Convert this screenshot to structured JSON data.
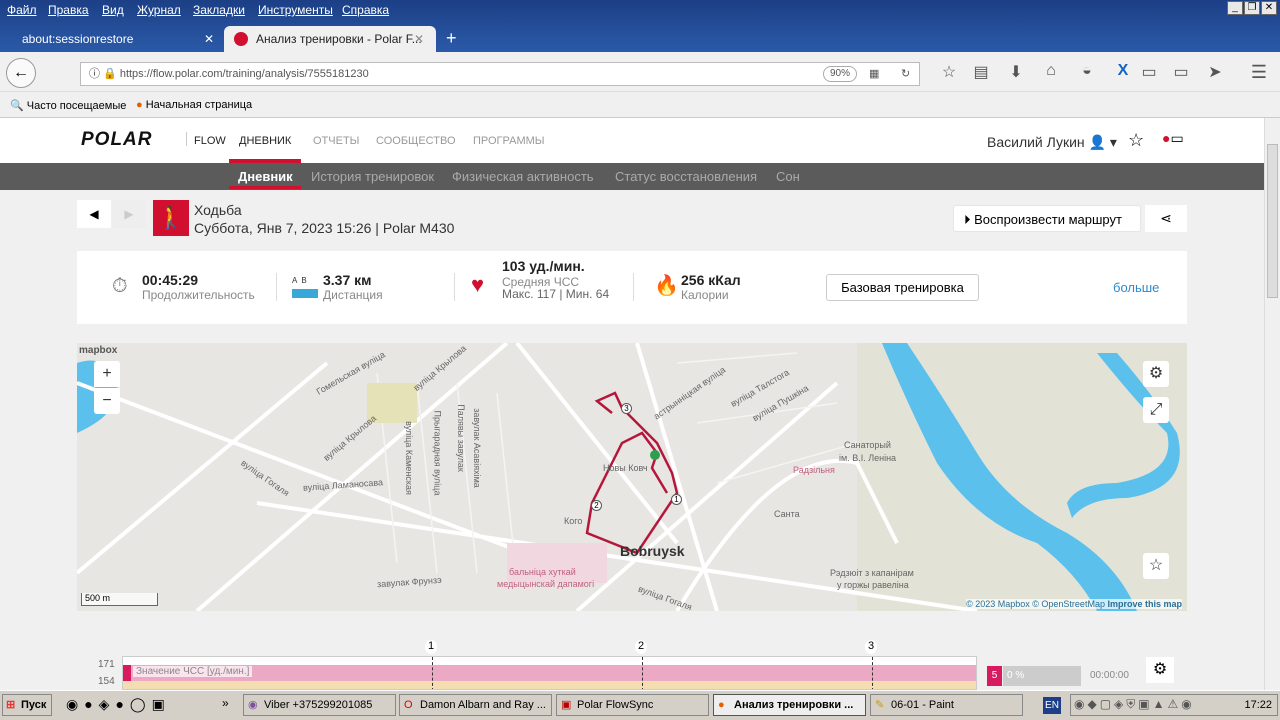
{
  "browser": {
    "menu": [
      "Файл",
      "Правка",
      "Вид",
      "Журнал",
      "Закладки",
      "Инструменты",
      "Справка"
    ],
    "tabs": [
      {
        "label": "about:sessionrestore"
      },
      {
        "label": "Анализ тренировки - Polar F..."
      }
    ],
    "url": "https://flow.polar.com/training/analysis/7555181230",
    "zoom": "90%",
    "bookmarks": [
      "Часто посещаемые",
      "Начальная страница"
    ]
  },
  "site": {
    "logo": "POLAR",
    "flow": "FLOW",
    "topnav": [
      "ДНЕВНИК",
      "ОТЧЕТЫ",
      "СООБЩЕСТВО",
      "ПРОГРАММЫ"
    ],
    "user": "Василий Лукин",
    "subnav": [
      "Дневник",
      "История тренировок",
      "Физическая активность",
      "Статус восстановления",
      "Сон"
    ]
  },
  "training": {
    "sport": "Ходьба",
    "date": "Суббота, Янв 7, 2023 15:26 | Polar M430",
    "replay": "Воспроизвести маршрут",
    "duration": "00:45:29",
    "duration_label": "Продолжительность",
    "distance_ab": "A  B",
    "distance": "3.37 км",
    "distance_label": "Дистанция",
    "hr": "103 уд./мин.",
    "hr_label": "Средняя ЧСС",
    "hr_minmax": "Макс. 117  |  Мин. 64",
    "calories": "256 кКал",
    "calories_label": "Калории",
    "type_button": "Базовая тренировка",
    "more": "больше"
  },
  "map": {
    "brand": "mapbox",
    "scale": "500 m",
    "attribution": [
      "© 2023 Mapbox",
      "© OpenStreetMap",
      "Improve this map"
    ],
    "labels": [
      "вуліца Гогаля",
      "вуліца Крылова",
      "вуліца Крылова",
      "Гомельская вуліца",
      "вуліца Ламаносава",
      "вуліца Каменская",
      "Прыгарадная вуліца",
      "Палявы завулак",
      "завулак Асавіяхіма",
      "завулак Фрунзэ",
      "бальніца хуткай",
      "медыцынскай дапамогі",
      "Bobruysk",
      "Радзільня",
      "Санаторый",
      "ім. В.І. Леніна",
      "Санта",
      "Рэдзюіт з капанірам",
      "у горжы равеліна",
      "вуліца Талстога",
      "вуліца Пушкіна",
      "астрынніцкая вуліца",
      "вуліца Гогаля",
      "Кого",
      "Новы Ковч"
    ],
    "markers": [
      "1",
      "2",
      "3"
    ]
  },
  "chart": {
    "y_ticks": [
      "171",
      "154"
    ],
    "laps": [
      "1",
      "2",
      "3"
    ],
    "series_label": "Значение ЧСС [уд./мин.]",
    "zone": "5",
    "zone_pct": "0 %",
    "zone_time": "00:00:00"
  },
  "taskbar": {
    "start": "Пуск",
    "tasks": [
      "Viber +375299201085",
      "Damon Albarn and Ray ...",
      "Polar FlowSync",
      "Анализ тренировки ...",
      "06-01 - Paint"
    ],
    "lang": "EN",
    "clock": "17:22"
  },
  "colors": {
    "accent": "#d0102e",
    "route": "#b5173c",
    "water": "#5bc0eb"
  }
}
